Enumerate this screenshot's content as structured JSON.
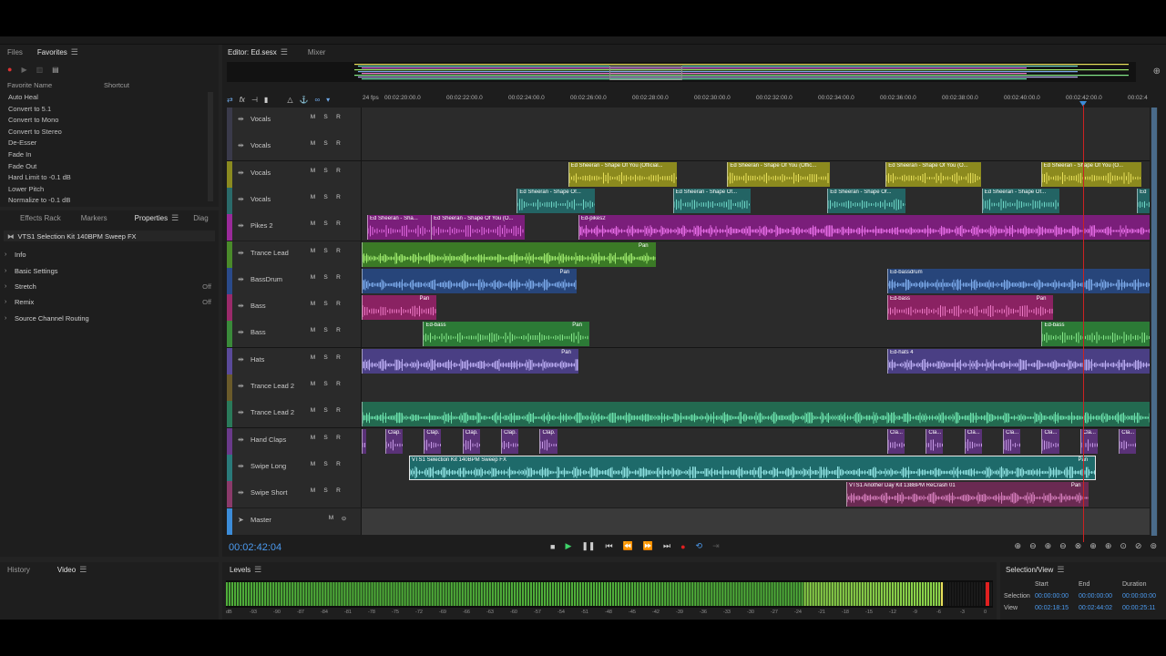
{
  "colors": {
    "accent": "#4c9bf0",
    "playhead": "#cc2222",
    "panel_bg": "#1e1e1e",
    "lane_bg": "#2b2b2b"
  },
  "files_panel": {
    "tabs": [
      "Files",
      "Favorites"
    ],
    "toolbar_icons": [
      "record-icon",
      "play-icon",
      "delete-icon",
      "settings-icon"
    ],
    "columns": [
      "Favorite Name",
      "Shortcut"
    ],
    "favorites": [
      "Auto Heal",
      "Convert to 5.1",
      "Convert to Mono",
      "Convert to Stereo",
      "De-Esser",
      "Fade In",
      "Fade Out",
      "Hard Limit to -0.1 dB",
      "Lower Pitch",
      "Normalize to -0.1 dB"
    ]
  },
  "props_panel": {
    "tabs": [
      "Effects Rack",
      "Markers",
      "Properties",
      "Diag"
    ],
    "selection": "VTS1 Selection Kit 140BPM Sweep FX",
    "rows": [
      {
        "label": "Info",
        "value": ""
      },
      {
        "label": "Basic Settings",
        "value": ""
      },
      {
        "label": "Stretch",
        "value": "Off"
      },
      {
        "label": "Remix",
        "value": "Off"
      },
      {
        "label": "Source Channel Routing",
        "value": ""
      }
    ]
  },
  "editor": {
    "tabs": [
      "Editor: Ed.sesx",
      "Mixer"
    ],
    "fps": "24 fps",
    "ruler": [
      "00:02:20:00.0",
      "00:02:22:00.0",
      "00:02:24:00.0",
      "00:02:26:00.0",
      "00:02:28:00.0",
      "00:02:30:00.0",
      "00:02:32:00.0",
      "00:02:34:00.0",
      "00:02:36:00.0",
      "00:02:38:00.0",
      "00:02:40:00.0",
      "00:02:42:00.0",
      "00:02:4"
    ],
    "timecode": "00:02:42:04",
    "msr": [
      "M",
      "S",
      "R"
    ],
    "tracks": [
      {
        "name": "Vocals",
        "color": "#3a3a4a",
        "clips": []
      },
      {
        "name": "Vocals",
        "color": "#3a3a4a",
        "clips": []
      },
      {
        "name": "Vocals",
        "color": "#8a8a20",
        "clips": [
          {
            "title": "Ed Sheeran - Shape Of You (Official...",
            "start": 0.262,
            "end": 0.4,
            "color": "#8c8a1e",
            "wave": "#e8e05a",
            "pan": ""
          },
          {
            "title": "Ed Sheeran - Shape Of You (Offic...",
            "start": 0.464,
            "end": 0.594,
            "color": "#8c8a1e",
            "wave": "#e8e05a",
            "pan": ""
          },
          {
            "title": "Ed Sheeran - Shape Of You (O...",
            "start": 0.665,
            "end": 0.786,
            "color": "#8c8a1e",
            "wave": "#e8e05a",
            "pan": ""
          },
          {
            "title": "Ed Sheeran - Shape Of You (O...",
            "start": 0.862,
            "end": 0.99,
            "color": "#8c8a1e",
            "wave": "#e8e05a",
            "pan": ""
          }
        ]
      },
      {
        "name": "Vocals",
        "color": "#2a6a6a",
        "clips": [
          {
            "title": "Ed Sheeran - Shape Of...",
            "start": 0.197,
            "end": 0.296,
            "color": "#236464",
            "wave": "#6fd8c8",
            "pan": ""
          },
          {
            "title": "Ed Sheeran - Shape Of...",
            "start": 0.395,
            "end": 0.494,
            "color": "#236464",
            "wave": "#6fd8c8",
            "pan": ""
          },
          {
            "title": "Ed Sheeran - Shape Of...",
            "start": 0.591,
            "end": 0.69,
            "color": "#236464",
            "wave": "#6fd8c8",
            "pan": ""
          },
          {
            "title": "Ed Sheeran - Shape Of...",
            "start": 0.787,
            "end": 0.885,
            "color": "#236464",
            "wave": "#6fd8c8",
            "pan": ""
          },
          {
            "title": "Ed S",
            "start": 0.984,
            "end": 1.0,
            "color": "#236464",
            "wave": "#6fd8c8",
            "pan": ""
          }
        ]
      },
      {
        "name": "Pikes 2",
        "color": "#9a2a9a",
        "clips": [
          {
            "title": "Ed Sheeran - Sha...",
            "start": 0.007,
            "end": 0.088,
            "color": "#7a1e7a",
            "wave": "#e46ae4",
            "pan": ""
          },
          {
            "title": "Ed Sheeran - Shape Of You (O...",
            "start": 0.088,
            "end": 0.207,
            "color": "#7a1e7a",
            "wave": "#e46ae4",
            "pan": ""
          },
          {
            "title": "Ed-pikes2",
            "start": 0.275,
            "end": 1.0,
            "color": "#7a1e7a",
            "wave": "#e46ae4",
            "pan": ""
          }
        ]
      },
      {
        "name": "Trance Lead",
        "color": "#4a8a2a",
        "clips": [
          {
            "title": "",
            "start": 0.0,
            "end": 0.373,
            "color": "#3b7a26",
            "wave": "#9ae66a",
            "pan": "Pan"
          }
        ]
      },
      {
        "name": "BassDrum",
        "color": "#2a4a8a",
        "clips": [
          {
            "title": "",
            "start": 0.0,
            "end": 0.273,
            "color": "#27457a",
            "wave": "#7aa8e8",
            "pan": "Pan"
          },
          {
            "title": "Ed-bassdrum",
            "start": 0.667,
            "end": 1.0,
            "color": "#27457a",
            "wave": "#7aa8e8",
            "pan": ""
          }
        ]
      },
      {
        "name": "Bass",
        "color": "#9a2a6a",
        "clips": [
          {
            "title": "",
            "start": 0.0,
            "end": 0.095,
            "color": "#8a2262",
            "wave": "#f07ac8",
            "pan": "Pan"
          },
          {
            "title": "Ed-bass",
            "start": 0.667,
            "end": 0.878,
            "color": "#8a2262",
            "wave": "#f07ac8",
            "pan": "Pan"
          }
        ]
      },
      {
        "name": "Bass",
        "color": "#3a8a3a",
        "clips": [
          {
            "title": "Ed-bass",
            "start": 0.078,
            "end": 0.289,
            "color": "#2c7a36",
            "wave": "#86ea8a",
            "pan": "Pan"
          },
          {
            "title": "Ed-bass",
            "start": 0.863,
            "end": 1.0,
            "color": "#2c7a36",
            "wave": "#86ea8a",
            "pan": ""
          }
        ]
      },
      {
        "name": "Hats",
        "color": "#5a4a9a",
        "clips": [
          {
            "title": "",
            "start": 0.0,
            "end": 0.275,
            "color": "#4a3f84",
            "wave": "#b8aaf0",
            "pan": "Pan"
          },
          {
            "title": "Ed-hats 4",
            "start": 0.667,
            "end": 1.0,
            "color": "#4a3f84",
            "wave": "#b8aaf0",
            "pan": ""
          }
        ]
      },
      {
        "name": "Trance Lead 2",
        "color": "#6a5a2a",
        "clips": []
      },
      {
        "name": "Trance Lead 2",
        "color": "#2a7a5a",
        "clips": [
          {
            "title": "",
            "start": 0.0,
            "end": 1.0,
            "color": "#236a50",
            "wave": "#6ae0aa",
            "pan": ""
          }
        ]
      },
      {
        "name": "Hand Claps",
        "color": "#6a3a8a",
        "clips": [
          {
            "title": "",
            "start": 0.0,
            "end": 0.006,
            "color": "#5a3278",
            "wave": "#c89ae8",
            "pan": ""
          },
          {
            "title": "Clap...",
            "start": 0.03,
            "end": 0.052,
            "color": "#5a3278",
            "wave": "#c89ae8",
            "pan": ""
          },
          {
            "title": "Clap...",
            "start": 0.079,
            "end": 0.101,
            "color": "#5a3278",
            "wave": "#c89ae8",
            "pan": ""
          },
          {
            "title": "Clap...",
            "start": 0.128,
            "end": 0.15,
            "color": "#5a3278",
            "wave": "#c89ae8",
            "pan": ""
          },
          {
            "title": "Clap...",
            "start": 0.177,
            "end": 0.199,
            "color": "#5a3278",
            "wave": "#c89ae8",
            "pan": ""
          },
          {
            "title": "Clap...",
            "start": 0.226,
            "end": 0.248,
            "color": "#5a3278",
            "wave": "#c89ae8",
            "pan": ""
          },
          {
            "title": "Cla...",
            "start": 0.667,
            "end": 0.689,
            "color": "#5a3278",
            "wave": "#c89ae8",
            "pan": ""
          },
          {
            "title": "Cla...",
            "start": 0.716,
            "end": 0.738,
            "color": "#5a3278",
            "wave": "#c89ae8",
            "pan": ""
          },
          {
            "title": "Cla...",
            "start": 0.765,
            "end": 0.787,
            "color": "#5a3278",
            "wave": "#c89ae8",
            "pan": ""
          },
          {
            "title": "Cla...",
            "start": 0.814,
            "end": 0.836,
            "color": "#5a3278",
            "wave": "#c89ae8",
            "pan": ""
          },
          {
            "title": "Cla...",
            "start": 0.863,
            "end": 0.885,
            "color": "#5a3278",
            "wave": "#c89ae8",
            "pan": ""
          },
          {
            "title": "Cla...",
            "start": 0.912,
            "end": 0.934,
            "color": "#5a3278",
            "wave": "#c89ae8",
            "pan": ""
          },
          {
            "title": "Cla...",
            "start": 0.961,
            "end": 0.983,
            "color": "#5a3278",
            "wave": "#c89ae8",
            "pan": ""
          }
        ]
      },
      {
        "name": "Swipe Long",
        "color": "#2a7a7a",
        "clips": [
          {
            "title": "VTS1 Selection Kit 140BPM Sweep FX",
            "start": 0.06,
            "end": 0.932,
            "color": "#1e6a6a",
            "wave": "#8ee0e0",
            "pan": "Pan"
          }
        ]
      },
      {
        "name": "Swipe Short",
        "color": "#8a3a6a",
        "clips": [
          {
            "title": "VTS1 Another Day Kit 138BPM ReCrash 01",
            "start": 0.615,
            "end": 0.922,
            "color": "#6a2a52",
            "wave": "#d27ab8",
            "pan": "Pan"
          }
        ]
      },
      {
        "name": "Master",
        "color": "#3c8cd8",
        "clips": []
      }
    ]
  },
  "history_panel": {
    "tabs": [
      "History",
      "Video"
    ]
  },
  "levels_panel": {
    "title": "Levels",
    "level": 0.935,
    "scale": [
      "dB",
      "-93",
      "-90",
      "-87",
      "-84",
      "-81",
      "-78",
      "-75",
      "-72",
      "-69",
      "-66",
      "-63",
      "-60",
      "-57",
      "-54",
      "-51",
      "-48",
      "-45",
      "-42",
      "-39",
      "-36",
      "-33",
      "-30",
      "-27",
      "-24",
      "-21",
      "-18",
      "-15",
      "-12",
      "-9",
      "-6",
      "-3",
      "0"
    ]
  },
  "selview_panel": {
    "title": "Selection/View",
    "headers": [
      "Start",
      "End",
      "Duration"
    ],
    "selection": {
      "label": "Selection",
      "start": "00:00:00:00",
      "end": "00:00:00:00",
      "duration": "00:00:00:00"
    },
    "view": {
      "label": "View",
      "start": "00:02:18:15",
      "end": "00:02:44:02",
      "duration": "00:00:25:11"
    }
  }
}
